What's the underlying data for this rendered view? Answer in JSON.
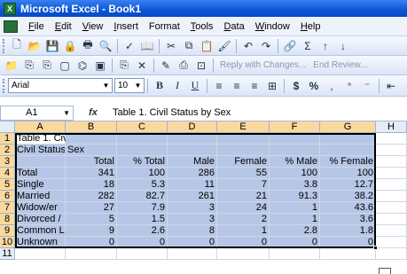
{
  "window": {
    "title": "Microsoft Excel - Book1"
  },
  "menu": {
    "items": [
      {
        "first": "F",
        "rest": "ile"
      },
      {
        "first": "E",
        "rest": "dit"
      },
      {
        "first": "V",
        "rest": "iew"
      },
      {
        "first": "I",
        "rest": "nsert"
      },
      {
        "first": "Fo",
        "rest": "rmat"
      },
      {
        "first": "T",
        "rest": "ools"
      },
      {
        "first": "D",
        "rest": "ata"
      },
      {
        "first": "W",
        "rest": "indow"
      },
      {
        "first": "H",
        "rest": "elp"
      }
    ]
  },
  "toolbar2": {
    "reply_label": "Reply with Changes...",
    "end_review_label": "End Review..."
  },
  "format_bar": {
    "font": "Arial",
    "size": "10",
    "currency": "$",
    "percent": "%"
  },
  "formula_bar": {
    "cell_ref": "A1",
    "fx": "fx",
    "content": "Table 1. Civil Status by Sex"
  },
  "columns": [
    "A",
    "B",
    "C",
    "D",
    "E",
    "F",
    "G",
    "H"
  ],
  "rows": [
    {
      "n": "1",
      "cells": [
        "Table 1. Civil Status by Sex",
        "",
        "",
        "",
        "",
        "",
        ""
      ]
    },
    {
      "n": "2",
      "cells": [
        "Civil Status",
        "Sex",
        "",
        "",
        "",
        "",
        ""
      ]
    },
    {
      "n": "3",
      "cells": [
        "",
        "Total",
        "% Total",
        "Male",
        "Female",
        "% Male",
        "% Female"
      ]
    },
    {
      "n": "4",
      "cells": [
        "Total",
        "341",
        "100",
        "286",
        "55",
        "100",
        "100"
      ]
    },
    {
      "n": "5",
      "cells": [
        "Single",
        "18",
        "5.3",
        "11",
        "7",
        "3.8",
        "12.7"
      ]
    },
    {
      "n": "6",
      "cells": [
        "Married",
        "282",
        "82.7",
        "261",
        "21",
        "91.3",
        "38.2"
      ]
    },
    {
      "n": "7",
      "cells": [
        "Widow/er",
        "27",
        "7.9",
        "3",
        "24",
        "1",
        "43.6"
      ]
    },
    {
      "n": "8",
      "cells": [
        "Divorced /",
        "5",
        "1.5",
        "3",
        "2",
        "1",
        "3.6"
      ]
    },
    {
      "n": "9",
      "cells": [
        "Common L",
        "9",
        "2.6",
        "8",
        "1",
        "2.8",
        "1.8"
      ]
    },
    {
      "n": "10",
      "cells": [
        "Unknown",
        "0",
        "0",
        "0",
        "0",
        "0",
        "0"
      ]
    },
    {
      "n": "11",
      "cells": [
        "",
        "",
        "",
        "",
        "",
        "",
        ""
      ]
    }
  ]
}
